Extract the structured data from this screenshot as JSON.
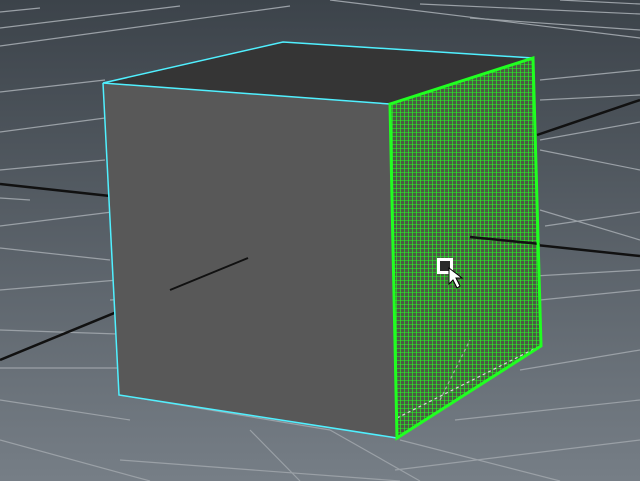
{
  "viewport": {
    "background_top": "#3c434a",
    "background_bottom": "#767e86",
    "grid_color": "#9aa0a6",
    "axis_color": "#111111"
  },
  "cube": {
    "face_color": "#585858",
    "top_color": "#353535",
    "side_mesh_color": "#4c5a44",
    "selection_outline_color": "#50f0ff",
    "highlight_face_color": "#20ff20",
    "hidden_edge_color": "#d8d8d8"
  },
  "cursor": {
    "icon": "move-select-cursor-icon"
  }
}
